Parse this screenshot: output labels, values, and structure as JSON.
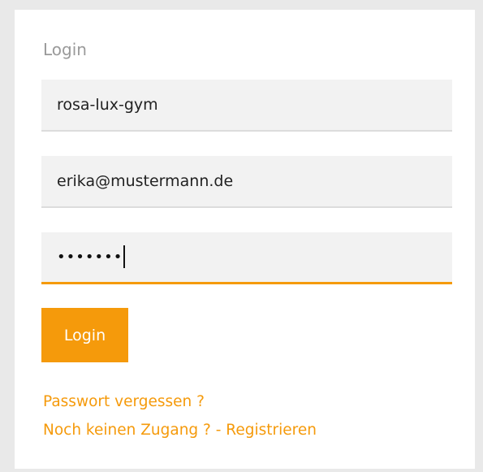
{
  "form": {
    "title": "Login",
    "school_value": "rosa-lux-gym",
    "email_value": "erika@mustermann.de",
    "password_masked": "•••••••",
    "login_button_label": "Login",
    "forgot_password_link": "Passwort vergessen ?",
    "register_link": "Noch keinen Zugang ? - Registrieren"
  },
  "colors": {
    "accent": "#f59a0b",
    "field_bg": "#f2f2f2",
    "page_bg": "#e9e9e9"
  }
}
